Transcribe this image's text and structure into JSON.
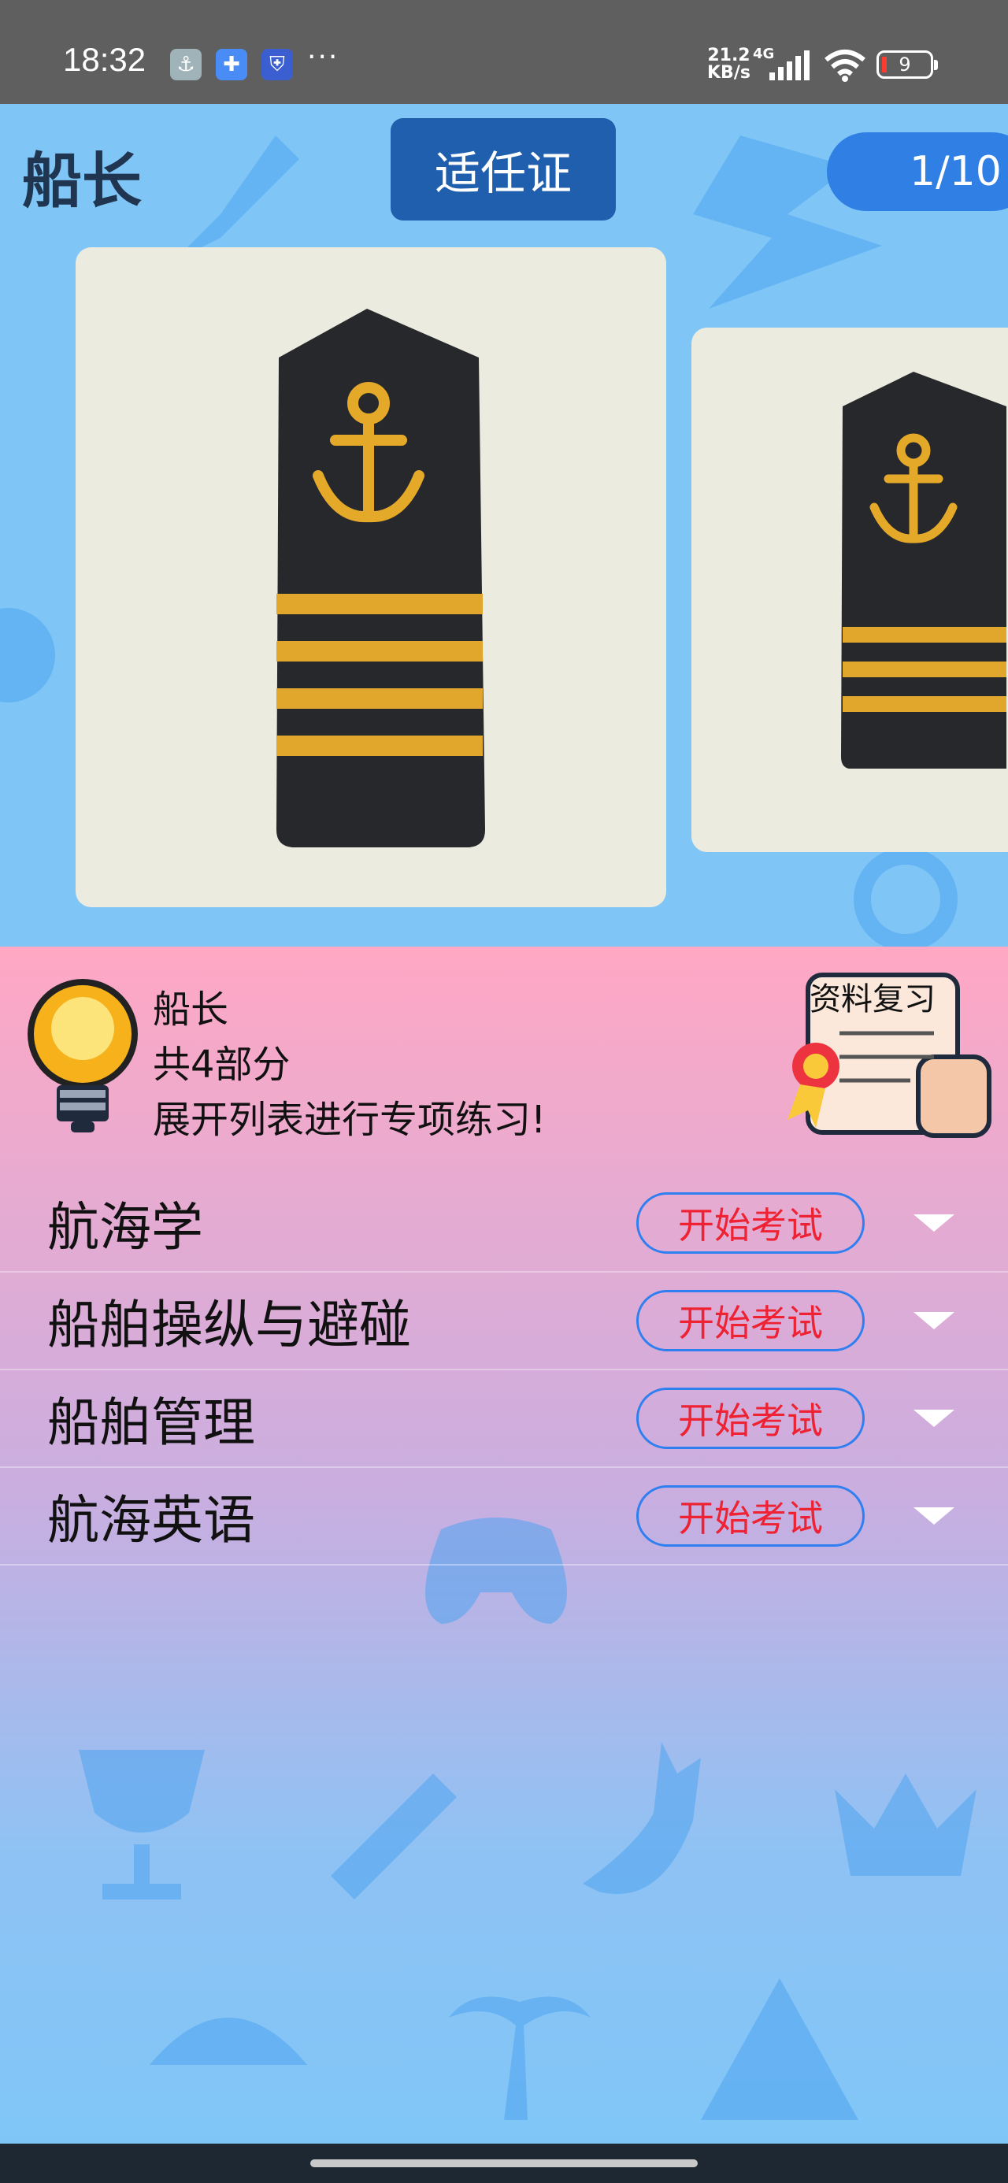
{
  "status_bar": {
    "time": "18:32",
    "dots": "···",
    "net_speed": "21.2",
    "net_unit": "KB/s",
    "net_type": "4G",
    "battery": "9"
  },
  "header": {
    "title": "船长",
    "cert_button": "适任证",
    "counter": "1/10"
  },
  "info": {
    "rank": "船长",
    "parts": "共4部分",
    "hint": "展开列表进行专项练习!",
    "review_label": "资料复习"
  },
  "subjects": [
    {
      "name": "航海学",
      "button": "开始考试"
    },
    {
      "name": "船舶操纵与避碰",
      "button": "开始考试"
    },
    {
      "name": "船舶管理",
      "button": "开始考试"
    },
    {
      "name": "航海英语",
      "button": "开始考试"
    }
  ],
  "colors": {
    "accent_blue": "#1f5fae",
    "counter_blue": "#2f7fe5",
    "exam_text": "#ee2233",
    "exam_border": "#2f7ff0"
  }
}
